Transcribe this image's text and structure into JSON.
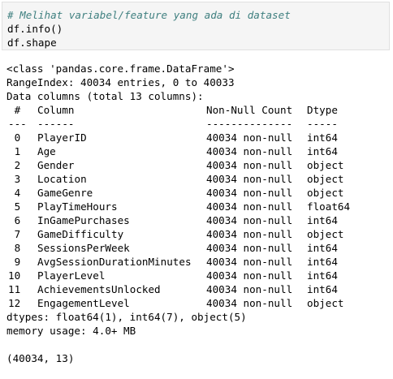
{
  "input": {
    "comment": "# Melihat variabel/feature yang ada di dataset",
    "lines": [
      "df.info()",
      "df.shape"
    ]
  },
  "output": {
    "class_line": "<class 'pandas.core.frame.DataFrame'>",
    "range_index": "RangeIndex: 40034 entries, 0 to 40033",
    "data_columns": "Data columns (total 13 columns):",
    "header": {
      "idx": " #",
      "column": "Column",
      "count": "Non-Null Count",
      "dtype": "Dtype"
    },
    "separator": {
      "idx": "---",
      "column": "------",
      "count": "--------------",
      "dtype": "-----"
    },
    "rows": [
      {
        "idx": " 0",
        "column": "PlayerID",
        "count": "40034 non-null",
        "dtype": "int64"
      },
      {
        "idx": " 1",
        "column": "Age",
        "count": "40034 non-null",
        "dtype": "int64"
      },
      {
        "idx": " 2",
        "column": "Gender",
        "count": "40034 non-null",
        "dtype": "object"
      },
      {
        "idx": " 3",
        "column": "Location",
        "count": "40034 non-null",
        "dtype": "object"
      },
      {
        "idx": " 4",
        "column": "GameGenre",
        "count": "40034 non-null",
        "dtype": "object"
      },
      {
        "idx": " 5",
        "column": "PlayTimeHours",
        "count": "40034 non-null",
        "dtype": "float64"
      },
      {
        "idx": " 6",
        "column": "InGamePurchases",
        "count": "40034 non-null",
        "dtype": "int64"
      },
      {
        "idx": " 7",
        "column": "GameDifficulty",
        "count": "40034 non-null",
        "dtype": "object"
      },
      {
        "idx": " 8",
        "column": "SessionsPerWeek",
        "count": "40034 non-null",
        "dtype": "int64"
      },
      {
        "idx": " 9",
        "column": "AvgSessionDurationMinutes",
        "count": "40034 non-null",
        "dtype": "int64"
      },
      {
        "idx": "10",
        "column": "PlayerLevel",
        "count": "40034 non-null",
        "dtype": "int64"
      },
      {
        "idx": "11",
        "column": "AchievementsUnlocked",
        "count": "40034 non-null",
        "dtype": "int64"
      },
      {
        "idx": "12",
        "column": "EngagementLevel",
        "count": "40034 non-null",
        "dtype": "object"
      }
    ],
    "dtypes": "dtypes: float64(1), int64(7), object(5)",
    "memory": "memory usage: 4.0+ MB",
    "shape": "(40034, 13)"
  },
  "colors": {
    "comment": "#408080",
    "input_bg": "#f5f5f5"
  }
}
